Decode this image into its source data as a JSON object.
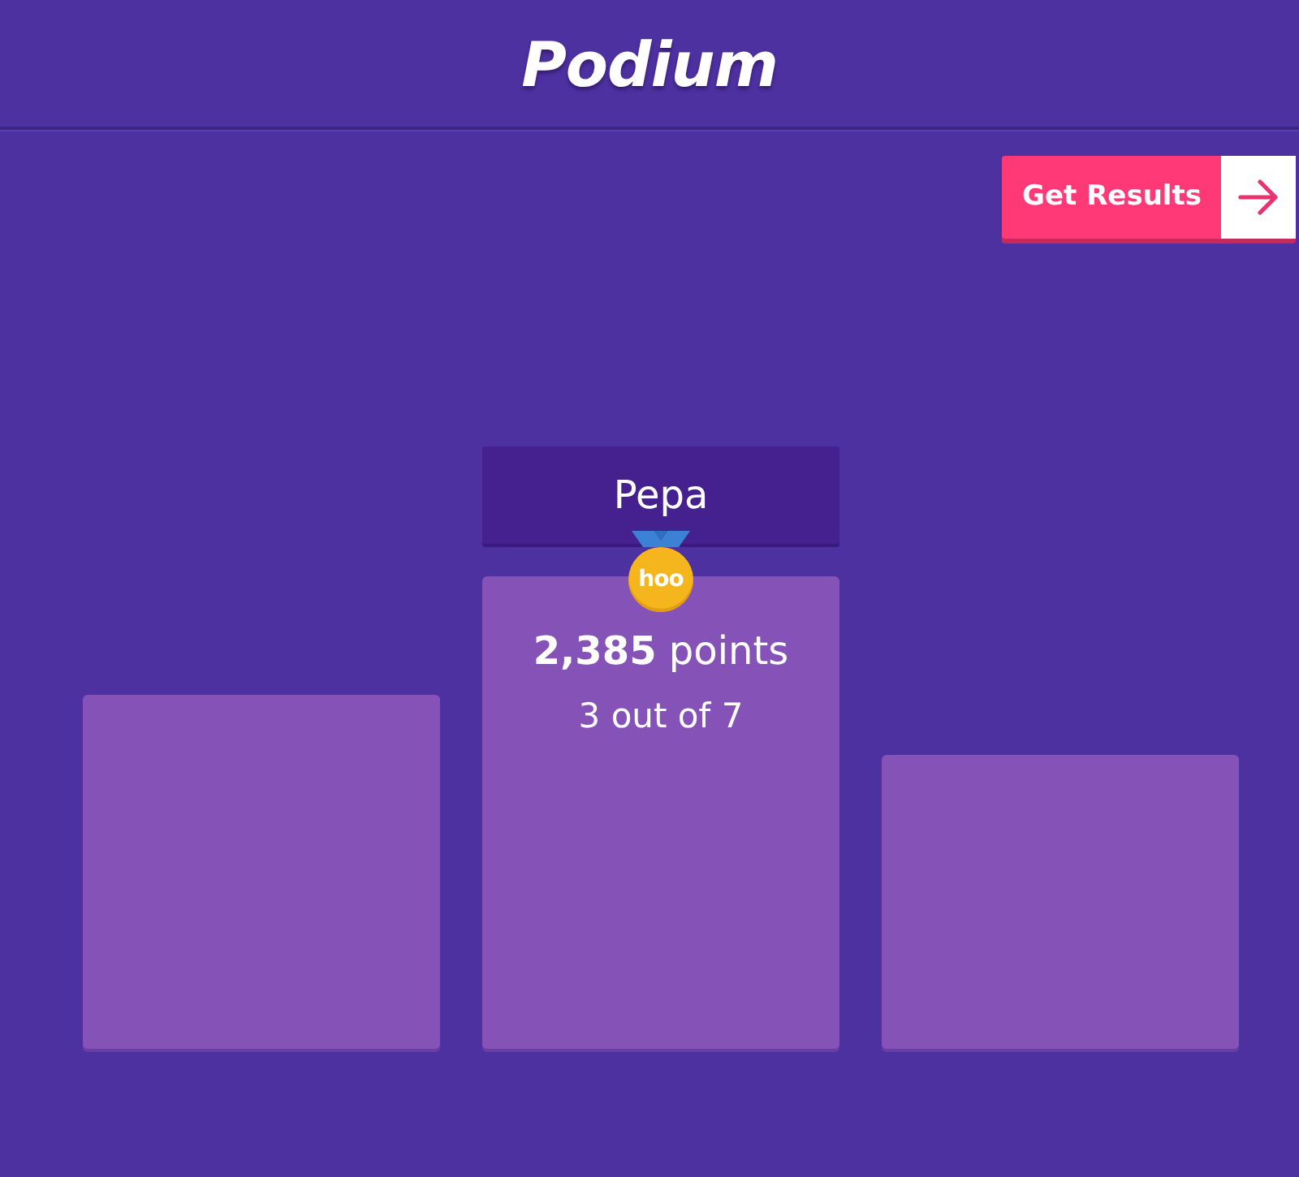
{
  "header": {
    "title": "Podium"
  },
  "results_button": {
    "label": "Get Results"
  },
  "podium": [
    {
      "kind": "second"
    },
    {
      "kind": "first",
      "player": {
        "name": "Pepa",
        "medal_text": "hoo",
        "score": "**2,385** points",
        "progress": "3 out of 7"
      }
    },
    {
      "kind": "third"
    }
  ]
}
